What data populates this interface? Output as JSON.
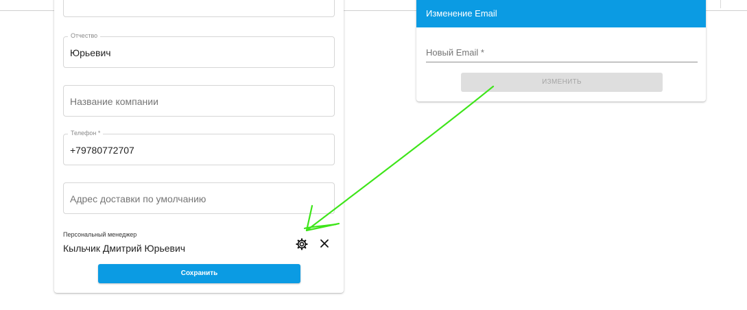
{
  "profile_form": {
    "fields": [
      {
        "name": "patronymic",
        "label": "Отчество",
        "value": "Юрьевич"
      },
      {
        "name": "company",
        "placeholder": "Название компании"
      },
      {
        "name": "phone",
        "label": "Телефон *",
        "value": "+79780772707"
      },
      {
        "name": "address",
        "placeholder": "Адрес доставки по умолчанию"
      }
    ],
    "manager": {
      "label": "Персональный менеджер",
      "name": "Кыльчик Дмитрий Юрьевич"
    },
    "save_label": "Сохранить",
    "accent_color": "#0b9be3"
  },
  "email_change": {
    "title": "Изменение Email",
    "new_email_placeholder": "Новый Email *",
    "change_label": "ИЗМЕНИТЬ"
  },
  "icons": {
    "settings": "gear-icon",
    "remove": "close-icon"
  },
  "annotation": {
    "color": "#3ee51a"
  }
}
